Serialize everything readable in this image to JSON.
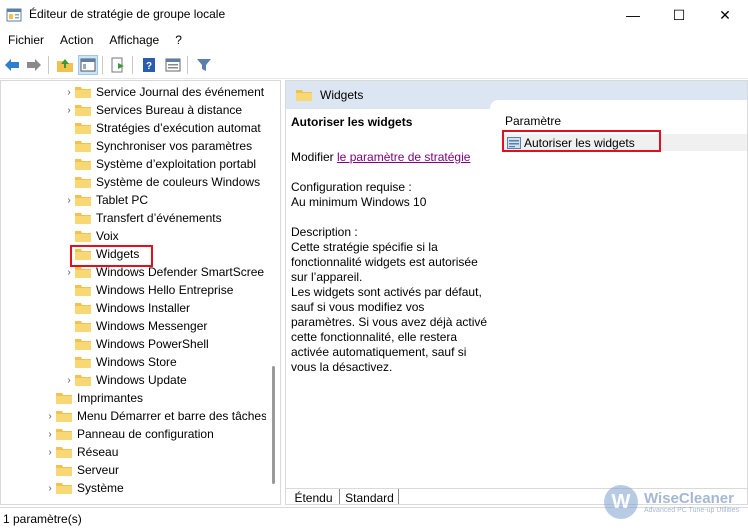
{
  "window": {
    "title": "Éditeur de stratégie de groupe locale",
    "controls": {
      "minimize": "—",
      "maximize": "☐",
      "close": "✕"
    }
  },
  "menu": [
    "Fichier",
    "Action",
    "Affichage",
    "?"
  ],
  "toolbar": [
    "back-icon",
    "forward-icon",
    "up-folder-icon",
    "show-hide-tree-icon",
    "export-list-icon",
    "help-icon",
    "properties-icon",
    "filter-icon"
  ],
  "tree": {
    "items": [
      {
        "label": "Service Journal des événement",
        "expander": "›"
      },
      {
        "label": "Services Bureau à distance",
        "expander": "›"
      },
      {
        "label": "Stratégies d’exécution automat",
        "expander": ""
      },
      {
        "label": "Synchroniser vos paramètres",
        "expander": ""
      },
      {
        "label": "Système d’exploitation portabl",
        "expander": ""
      },
      {
        "label": "Système de couleurs Windows",
        "expander": ""
      },
      {
        "label": "Tablet PC",
        "expander": "›"
      },
      {
        "label": "Transfert d’événements",
        "expander": ""
      },
      {
        "label": "Voix",
        "expander": ""
      },
      {
        "label": "Widgets",
        "expander": ""
      },
      {
        "label": "Windows Defender SmartScree",
        "expander": "›"
      },
      {
        "label": "Windows Hello Entreprise",
        "expander": ""
      },
      {
        "label": "Windows Installer",
        "expander": ""
      },
      {
        "label": "Windows Messenger",
        "expander": ""
      },
      {
        "label": "Windows PowerShell",
        "expander": ""
      },
      {
        "label": "Windows Store",
        "expander": ""
      },
      {
        "label": "Windows Update",
        "expander": "›"
      },
      {
        "label": "Imprimantes",
        "expander": ""
      },
      {
        "label": "Menu Démarrer et barre des tâches",
        "expander": "›"
      },
      {
        "label": "Panneau de configuration",
        "expander": "›"
      },
      {
        "label": "Réseau",
        "expander": "›"
      },
      {
        "label": "Serveur",
        "expander": ""
      },
      {
        "label": "Système",
        "expander": "›"
      }
    ]
  },
  "right": {
    "header": "Widgets",
    "policy_title": "Autoriser les widgets",
    "modify_prefix": "Modifier ",
    "modify_link": "le paramètre de stratégie",
    "requirements_label": "Configuration requise :",
    "requirements_value": "Au minimum Windows 10",
    "description_label": "Description :",
    "description_text": "Cette stratégie spécifie si la fonctionnalité widgets est autorisée sur l’appareil.",
    "description_text2": "Les widgets sont activés par défaut, sauf si vous modifiez vos paramètres. Si vous avez déjà activé cette fonctionnalité, elle restera activée automatiquement, sauf si vous la désactivez.",
    "column_header": "Paramètre",
    "settings": [
      {
        "label": "Autoriser les widgets"
      }
    ],
    "tabs": [
      "Étendu",
      "Standard"
    ]
  },
  "status": {
    "text": "1 paramètre(s)"
  },
  "watermark": {
    "brand": "WiseCleaner",
    "tagline": "Advanced PC Tune-up Utilities",
    "letter": "W"
  },
  "colors": {
    "highlight": "#e0101e",
    "header_bg": "#dce6f2",
    "folder": "#f3c14d",
    "link": "#800080"
  }
}
